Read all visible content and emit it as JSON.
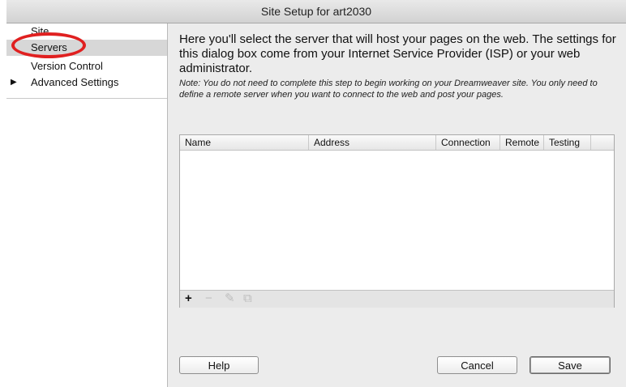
{
  "window": {
    "title": "Site Setup for art2030"
  },
  "sidebar": {
    "items": [
      {
        "label": "Site",
        "selected": false
      },
      {
        "label": "Servers",
        "selected": true
      },
      {
        "label": "Version Control",
        "selected": false
      },
      {
        "label": "Advanced Settings",
        "selected": false,
        "expandable": true
      }
    ],
    "arrow_glyph": "▶"
  },
  "main": {
    "intro": "Here you'll select the server that will host your pages on the web. The settings for this dialog box come from your Internet Service Provider (ISP) or your web administrator.",
    "note": "Note: You do not need to complete this step to begin working on your Dreamweaver site. You only need to define a remote server when you want to connect to the web and post your pages."
  },
  "servers_table": {
    "columns": [
      "Name",
      "Address",
      "Connection",
      "Remote",
      "Testing"
    ],
    "rows": [],
    "toolbar": [
      {
        "icon": "plus-icon",
        "glyph": "+",
        "enabled": true
      },
      {
        "icon": "minus-icon",
        "glyph": "−",
        "enabled": false
      },
      {
        "icon": "pencil-icon",
        "glyph": "✎",
        "enabled": false
      },
      {
        "icon": "duplicate-icon",
        "glyph": "⧉",
        "enabled": false
      }
    ]
  },
  "buttons": {
    "help": "Help",
    "cancel": "Cancel",
    "save": "Save"
  },
  "colors": {
    "annotation_ring": "#e02020",
    "selected_row": "#d7d7d7"
  }
}
